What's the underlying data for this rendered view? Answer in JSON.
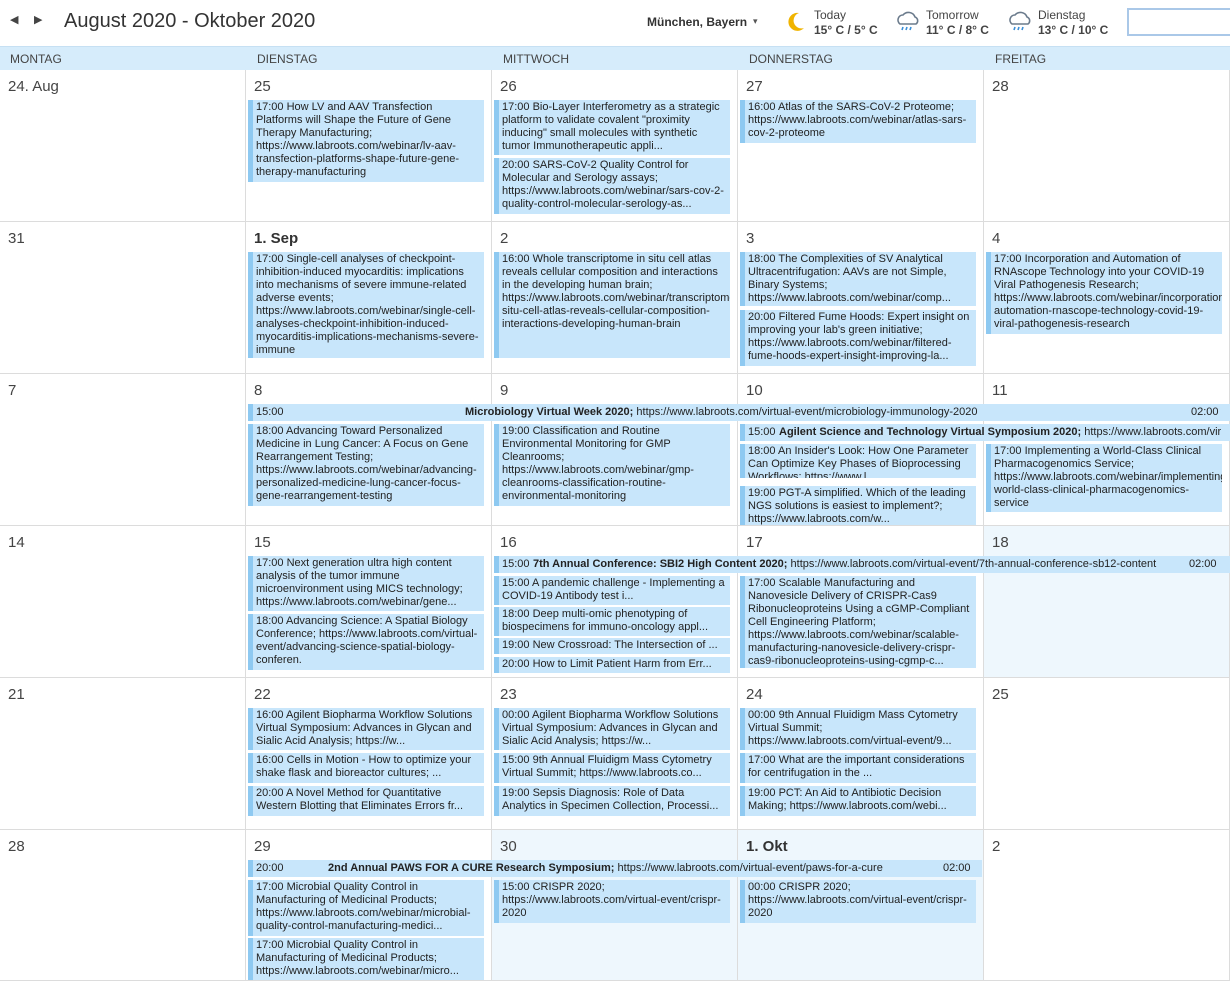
{
  "header": {
    "prev_label": "◀",
    "next_label": "▶",
    "range_title": "August 2020 - Oktober 2020",
    "location": "München, Bayern",
    "location_caret": "▾",
    "search_placeholder": ""
  },
  "weather": [
    {
      "label": "Today",
      "temp": "15° C / 5° C",
      "icon": "moon-icon"
    },
    {
      "label": "Tomorrow",
      "temp": "11° C / 8° C",
      "icon": "rain-cloud-icon"
    },
    {
      "label": "Dienstag",
      "temp": "13° C / 10° C",
      "icon": "rain-cloud-icon"
    }
  ],
  "weekdays": [
    "MONTAG",
    "DIENSTAG",
    "MITTWOCH",
    "DONNERSTAG",
    "FREITAG"
  ],
  "weeks": [
    {
      "days": [
        {
          "date": "24. Aug",
          "events": []
        },
        {
          "date": "25",
          "events": [
            "17:00 How LV and AAV Transfection Platforms will Shape the Future of Gene Therapy Manufacturing; https://www.labroots.com/webinar/lv-aav-transfection-platforms-shape-future-gene-therapy-manufacturing"
          ]
        },
        {
          "date": "26",
          "events": [
            "17:00 Bio-Layer Interferometry as a strategic platform to validate covalent \"proximity inducing\" small molecules with synthetic tumor Immunotherapeutic appli...",
            "20:00 SARS-CoV-2 Quality Control for Molecular and Serology assays; https://www.labroots.com/webinar/sars-cov-2-quality-control-molecular-serology-as..."
          ]
        },
        {
          "date": "27",
          "events": [
            "16:00 Atlas of the SARS-CoV-2 Proteome; https://www.labroots.com/webinar/atlas-sars-cov-2-proteome"
          ]
        },
        {
          "date": "28",
          "events": []
        }
      ]
    },
    {
      "days": [
        {
          "date": "31",
          "events": []
        },
        {
          "date": "1. Sep",
          "events": [
            "17:00 Single-cell analyses of checkpoint-inhibition-induced myocarditis: implications into mechanisms of severe immune-related adverse events; https://www.labroots.com/webinar/single-cell-analyses-checkpoint-inhibition-induced-myocarditis-implications-mechanisms-severe-immune"
          ]
        },
        {
          "date": "2",
          "events": [
            "16:00 Whole transcriptome in situ cell atlas reveals cellular composition and interactions in the developing human brain; https://www.labroots.com/webinar/transcriptome-situ-cell-atlas-reveals-cellular-composition-interactions-developing-human-brain"
          ]
        },
        {
          "date": "3",
          "events": [
            "18:00 The Complexities of SV Analytical Ultracentrifugation: AAVs are not Simple, Binary Systems; https://www.labroots.com/webinar/comp...",
            "20:00 Filtered Fume Hoods: Expert insight on improving your lab's green initiative; https://www.labroots.com/webinar/filtered-fume-hoods-expert-insight-improving-la..."
          ]
        },
        {
          "date": "4",
          "events": [
            "17:00 Incorporation and Automation of RNAscope Technology into your COVID-19 Viral Pathogenesis Research; https://www.labroots.com/webinar/incorporation-automation-rnascope-technology-covid-19-viral-pathogenesis-research"
          ]
        }
      ]
    },
    {
      "days": [
        {
          "date": "7",
          "events": []
        },
        {
          "date": "8",
          "events": [
            "18:00 Advancing Toward Personalized Medicine in Lung Cancer: A Focus on Gene Rearrangement Testing; https://www.labroots.com/webinar/advancing-personalized-medicine-lung-cancer-focus-gene-rearrangement-testing"
          ]
        },
        {
          "date": "9",
          "events": [
            "19:00 Classification and Routine Environmental Monitoring for GMP Cleanrooms; https://www.labroots.com/webinar/gmp-cleanrooms-classification-routine-environmental-monitoring"
          ]
        },
        {
          "date": "10",
          "events": [
            "18:00 An Insider's Look: How One Parameter Can Optimize Key Phases of Bioprocessing Workflows; https://www.l...",
            "19:00 PGT-A simplified. Which of the leading NGS solutions is easiest to implement?; https://www.labroots.com/w..."
          ]
        },
        {
          "date": "11",
          "events": [
            "17:00 Implementing a World-Class Clinical Pharmacogenomics Service; https://www.labroots.com/webinar/implementing-world-class-clinical-pharmacogenomics-service"
          ]
        }
      ]
    },
    {
      "days": [
        {
          "date": "14",
          "events": []
        },
        {
          "date": "15",
          "events": [
            "17:00 Next generation ultra high content analysis of the tumor immune microenvironment using MICS technology; https://www.labroots.com/webinar/gene...",
            "18:00 Advancing Science: A Spatial Biology Conference; https://www.labroots.com/virtual-event/advancing-science-spatial-biology-conferen."
          ]
        },
        {
          "date": "16",
          "events": [
            "15:00 A pandemic challenge - Implementing a COVID-19 Antibody test i...",
            "18:00 Deep multi-omic phenotyping of biospecimens for immuno-oncology appl...",
            "19:00 New Crossroad: The Intersection of ...",
            "20:00 How to Limit Patient Harm from Err..."
          ]
        },
        {
          "date": "17",
          "events": [
            "17:00 Scalable Manufacturing and Nanovesicle Delivery of CRISPR-Cas9 Ribonucleoproteins Using a cGMP-Compliant Cell Engineering Platform; https://www.labroots.com/webinar/scalable-manufacturing-nanovesicle-delivery-crispr-cas9-ribonucleoproteins-using-cgmp-c..."
          ]
        },
        {
          "date": "18",
          "events": []
        }
      ]
    },
    {
      "days": [
        {
          "date": "21",
          "events": []
        },
        {
          "date": "22",
          "events": [
            "16:00 Agilent Biopharma Workflow Solutions Virtual Symposium: Advances in Glycan and Sialic Acid Analysis; https://w...",
            "16:00 Cells in Motion - How to optimize your shake flask and bioreactor cultures; ...",
            "20:00 A Novel Method for Quantitative Western Blotting that Eliminates Errors fr..."
          ]
        },
        {
          "date": "23",
          "events": [
            "00:00 Agilent Biopharma Workflow Solutions Virtual Symposium: Advances in Glycan and Sialic Acid Analysis; https://w...",
            "15:00 9th Annual Fluidigm Mass Cytometry Virtual Summit; https://www.labroots.co...",
            "19:00 Sepsis Diagnosis: Role of Data Analytics in Specimen Collection, Processi..."
          ]
        },
        {
          "date": "24",
          "events": [
            "00:00 9th Annual Fluidigm Mass Cytometry Virtual Summit; https://www.labroots.com/virtual-event/9...",
            "17:00 What are the important considerations for centrifugation in the ...",
            "19:00 PCT: An Aid to Antibiotic Decision Making; https://www.labroots.com/webi..."
          ]
        },
        {
          "date": "25",
          "events": []
        }
      ]
    },
    {
      "days": [
        {
          "date": "28",
          "events": []
        },
        {
          "date": "29",
          "events": [
            "17:00 Microbial Quality Control in Manufacturing of Medicinal Products; https://www.labroots.com/webinar/microbial-quality-control-manufacturing-medici...",
            "17:00 Microbial Quality Control in Manufacturing of Medicinal Products; https://www.labroots.com/webinar/micro..."
          ]
        },
        {
          "date": "30",
          "events": [
            "15:00 CRISPR 2020; https://www.labroots.com/virtual-event/crispr-2020"
          ]
        },
        {
          "date": "1. Okt",
          "events": [
            "00:00 CRISPR 2020; https://www.labroots.com/virtual-event/crispr-2020"
          ]
        },
        {
          "date": "2",
          "events": []
        }
      ]
    }
  ],
  "banners": [
    {
      "start": "15:00",
      "title": "Microbiology Virtual Week 2020;",
      "url": "https://www.labroots.com/virtual-event/microbiology-immunology-2020",
      "end": "02:00"
    },
    {
      "start": "15:00",
      "title": "Agilent Science and Technology Virtual Symposium 2020;",
      "url": "https://www.labroots.com/vir",
      "end": ""
    },
    {
      "start": "15:00",
      "title": "7th Annual Conference: SBI2 High Content 2020;",
      "url": "https://www.labroots.com/virtual-event/7th-annual-conference-sb12-content",
      "end": "02:00"
    },
    {
      "start": "20:00",
      "title": "2nd Annual PAWS FOR A CURE Research Symposium;",
      "url": "https://www.labroots.com/virtual-event/paws-for-a-cure",
      "end": "02:00"
    }
  ],
  "colors": {
    "event_bg": "#c8e6fb",
    "event_bar": "#8ec9f1",
    "header_bg": "#d6ecfb",
    "shaded_cell": "#eef7fd"
  }
}
